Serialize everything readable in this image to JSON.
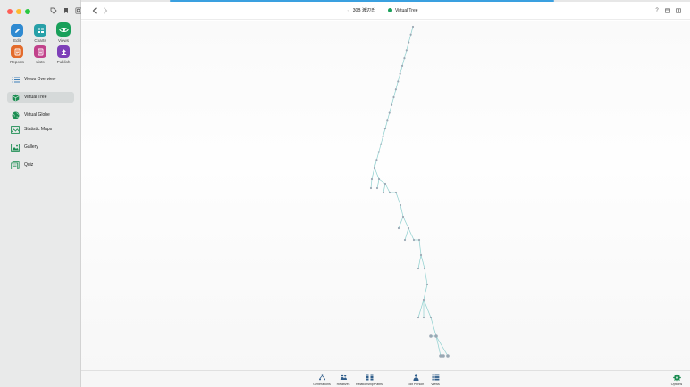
{
  "sidebar": {
    "toolbar": [
      {
        "label": "Edit",
        "icon": "pencil-icon",
        "color": "#2f8ad1"
      },
      {
        "label": "Charts",
        "icon": "charts-icon",
        "color": "#27a0a8"
      },
      {
        "label": "Views",
        "icon": "eye-icon",
        "color": "#19a05a"
      },
      {
        "label": "Reports",
        "icon": "reports-icon",
        "color": "#e36b2c"
      },
      {
        "label": "Lists",
        "icon": "lists-icon",
        "color": "#c1428b"
      },
      {
        "label": "Publish",
        "icon": "publish-icon",
        "color": "#7d3fb8"
      }
    ],
    "items": [
      {
        "label": "Views Overview",
        "icon": "list-icon"
      },
      {
        "label": "Virtual Tree",
        "icon": "cube-icon"
      },
      {
        "label": "Virtual Globe",
        "icon": "globe-icon"
      },
      {
        "label": "Statistic Maps",
        "icon": "map-icon"
      },
      {
        "label": "Gallery",
        "icon": "gallery-icon"
      },
      {
        "label": "Quiz",
        "icon": "quiz-icon"
      }
    ],
    "selected": "Virtual Tree"
  },
  "header": {
    "person": "30B 渡辺氏",
    "view": "Virtual Tree"
  },
  "bottombar": {
    "items": [
      {
        "label": "Generations",
        "icon": "generations-icon"
      },
      {
        "label": "Relatives",
        "icon": "relatives-icon"
      },
      {
        "label": "Relationship Paths",
        "icon": "relationship-paths-icon"
      },
      {
        "label": "Edit Person",
        "icon": "person-icon"
      },
      {
        "label": "Views",
        "icon": "views-icon"
      },
      {
        "label": "Options",
        "icon": "gear-icon"
      }
    ]
  },
  "colors": {
    "accent": "#19a05a",
    "tree_line": "#8fd0cf",
    "tree_node": "#9aa8b4"
  }
}
